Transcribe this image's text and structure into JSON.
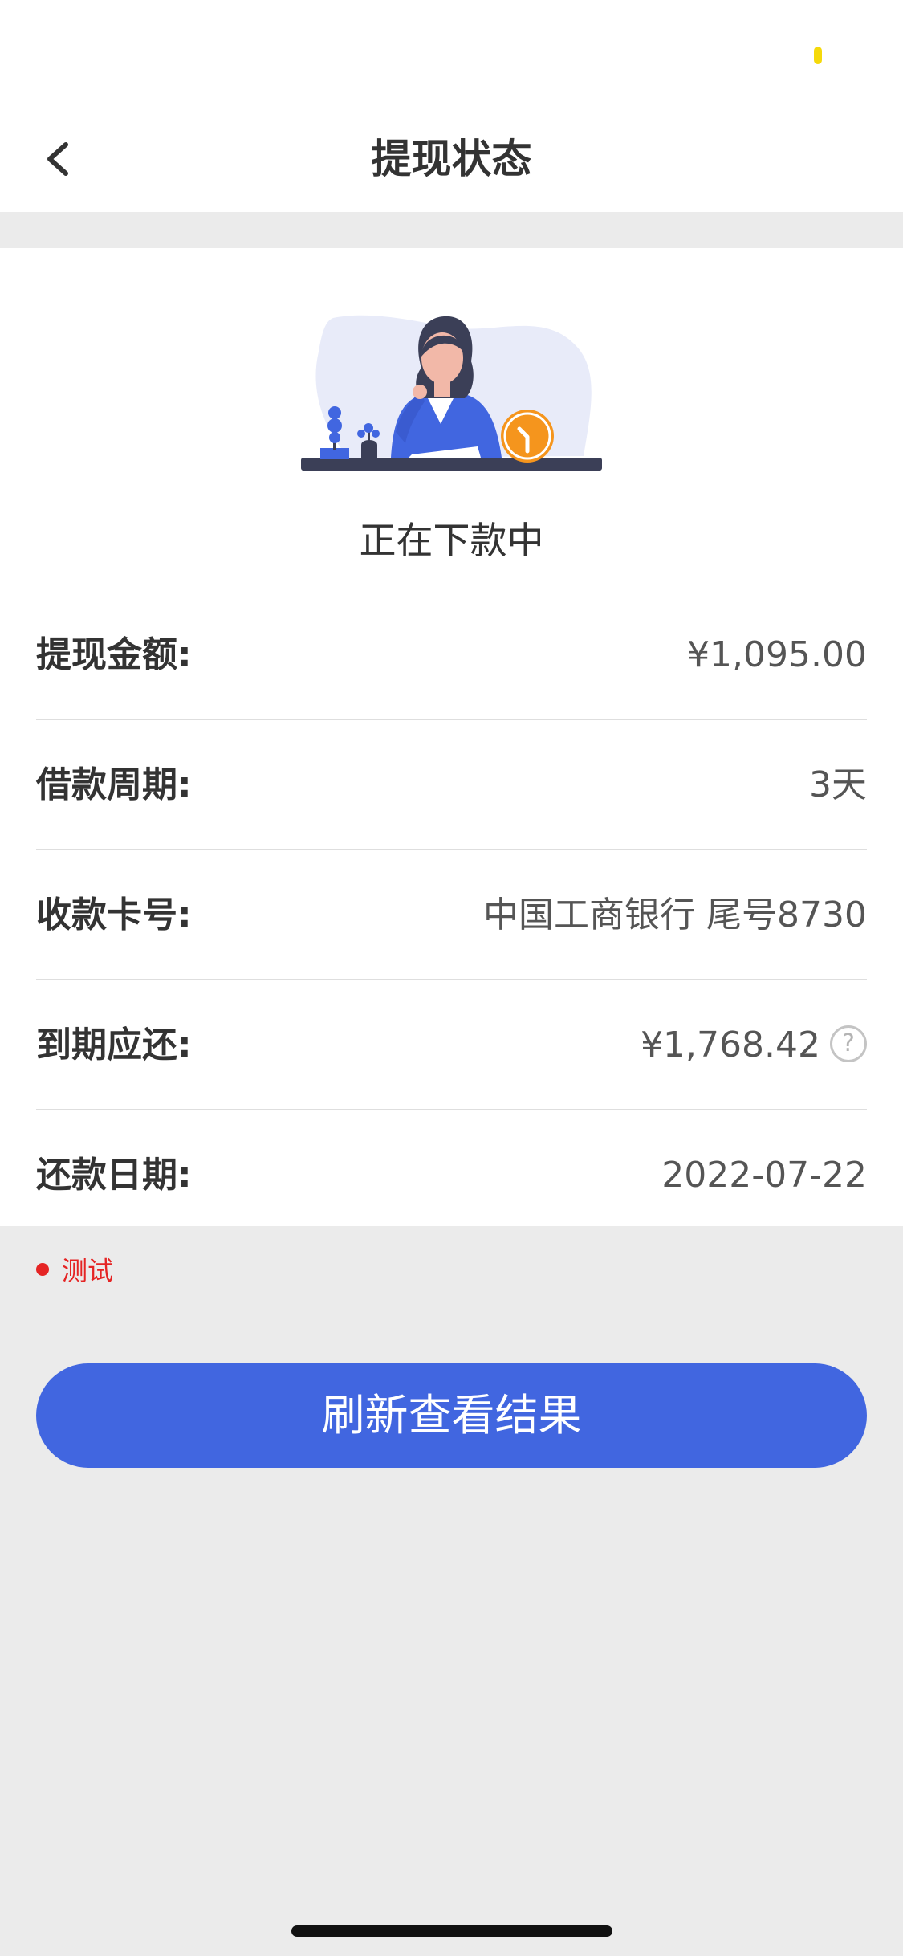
{
  "colors": {
    "accent": "#4166e0",
    "page_background": "#ebebeb",
    "note_red": "#e52424",
    "status_dot_yellow": "#f5d90a",
    "clock_orange": "#f5951d"
  },
  "nav": {
    "back_icon": "chevron-left-icon",
    "title": "提现状态"
  },
  "illustration": {
    "icon": "waiting-woman-clock-illustration"
  },
  "status": {
    "text": "正在下款中"
  },
  "details": [
    {
      "label": "提现金额:",
      "value": "¥1,095.00"
    },
    {
      "label": "借款周期:",
      "value": "3天"
    },
    {
      "label": "收款卡号:",
      "value": "中国工商银行 尾号8730"
    },
    {
      "label": "到期应还:",
      "value": "¥1,768.42",
      "help_icon": "question-circle-icon",
      "help_glyph": "?"
    },
    {
      "label": "还款日期:",
      "value": "2022-07-22"
    }
  ],
  "note": {
    "text": "测试"
  },
  "actions": {
    "refresh_label": "刷新查看结果"
  }
}
